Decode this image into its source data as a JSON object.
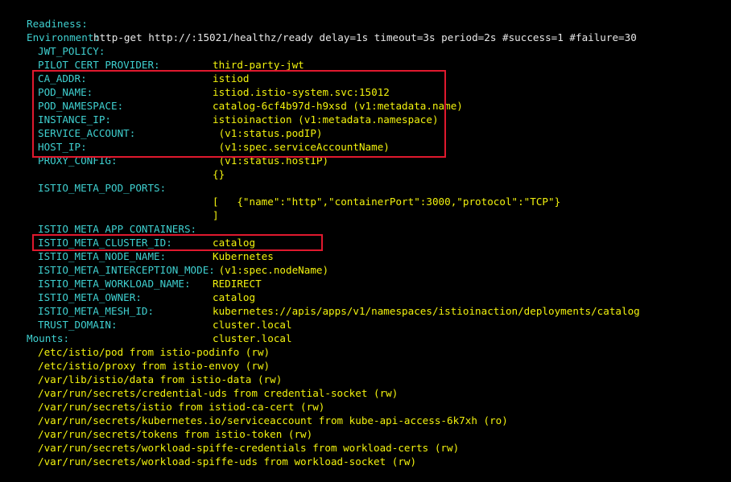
{
  "readiness": {
    "label": "Readiness:",
    "value": "http-get http://:15021/healthz/ready delay=1s timeout=3s period=2s #success=1 #failure=30"
  },
  "environment": {
    "label": "Environment:",
    "vars": [
      {
        "name": "JWT_POLICY:",
        "value": "third-party-jwt"
      },
      {
        "name": "PILOT_CERT_PROVIDER:",
        "value": "istiod"
      },
      {
        "name": "CA_ADDR:",
        "value": "istiod.istio-system.svc:15012"
      },
      {
        "name": "POD_NAME:",
        "value": "catalog-6cf4b97d-h9xsd (v1:metadata.name)"
      },
      {
        "name": "POD_NAMESPACE:",
        "value": "istioinaction (v1:metadata.namespace)"
      },
      {
        "name": "INSTANCE_IP:",
        "value": " (v1:status.podIP)"
      },
      {
        "name": "SERVICE_ACCOUNT:",
        "value": " (v1:spec.serviceAccountName)"
      },
      {
        "name": "HOST_IP:",
        "value": " (v1:status.hostIP)"
      },
      {
        "name": "PROXY_CONFIG:",
        "value": "{}"
      },
      {
        "name": "ISTIO_META_POD_PORTS:",
        "value": "["
      },
      {
        "name": "",
        "value": "    {\"name\":\"http\",\"containerPort\":3000,\"protocol\":\"TCP\"}"
      },
      {
        "name": "",
        "value": "]"
      },
      {
        "name": "ISTIO_META_APP_CONTAINERS:",
        "value": "catalog"
      },
      {
        "name": "ISTIO_META_CLUSTER_ID:",
        "value": "Kubernetes"
      },
      {
        "name": "ISTIO_META_NODE_NAME:",
        "value": " (v1:spec.nodeName)"
      },
      {
        "name": "ISTIO_META_INTERCEPTION_MODE:",
        "value": "REDIRECT"
      },
      {
        "name": "ISTIO_META_WORKLOAD_NAME:",
        "value": "catalog"
      },
      {
        "name": "ISTIO_META_OWNER:",
        "value": "kubernetes://apis/apps/v1/namespaces/istioinaction/deployments/catalog"
      },
      {
        "name": "ISTIO_META_MESH_ID:",
        "value": "cluster.local"
      },
      {
        "name": "TRUST_DOMAIN:",
        "value": "cluster.local"
      }
    ]
  },
  "mounts": {
    "label": "Mounts:",
    "items": [
      "/etc/istio/pod from istio-podinfo (rw)",
      "/etc/istio/proxy from istio-envoy (rw)",
      "/var/lib/istio/data from istio-data (rw)",
      "/var/run/secrets/credential-uds from credential-socket (rw)",
      "/var/run/secrets/istio from istiod-ca-cert (rw)",
      "/var/run/secrets/kubernetes.io/serviceaccount from kube-api-access-6k7xh (ro)",
      "/var/run/secrets/tokens from istio-token (rw)",
      "/var/run/secrets/workload-spiffe-credentials from workload-certs (rw)",
      "/var/run/secrets/workload-spiffe-uds from workload-socket (rw)"
    ]
  },
  "colors": {
    "background": "#000000",
    "label": "#3fd0d0",
    "value": "#f2f20e",
    "highlight_box": "#e0192e"
  }
}
